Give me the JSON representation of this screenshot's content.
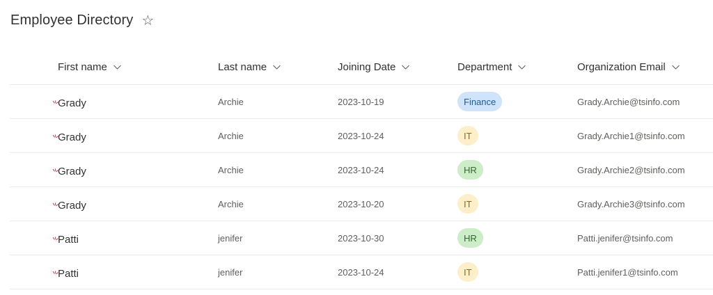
{
  "header": {
    "title": "Employee Directory",
    "favorite_icon": "star-outline-icon"
  },
  "columns": [
    {
      "key": "first_name",
      "label": "First name"
    },
    {
      "key": "last_name",
      "label": "Last name"
    },
    {
      "key": "joining_date",
      "label": "Joining Date"
    },
    {
      "key": "department",
      "label": "Department"
    },
    {
      "key": "email",
      "label": "Organization Email"
    }
  ],
  "department_colors": {
    "Finance": {
      "bg": "#cfe4fa",
      "fg": "#1e5a93"
    },
    "IT": {
      "bg": "#fcefc9",
      "fg": "#8a6d1c"
    },
    "HR": {
      "bg": "#cdecc8",
      "fg": "#2e6b2a"
    }
  },
  "new_item_icon": "new-item-sparkle-icon",
  "rows": [
    {
      "first_name": "Grady",
      "last_name": "Archie",
      "joining_date": "2023-10-19",
      "department": "Finance",
      "email": "Grady.Archie@tsinfo.com"
    },
    {
      "first_name": "Grady",
      "last_name": "Archie",
      "joining_date": "2023-10-24",
      "department": "IT",
      "email": "Grady.Archie1@tsinfo.com"
    },
    {
      "first_name": "Grady",
      "last_name": "Archie",
      "joining_date": "2023-10-24",
      "department": "HR",
      "email": "Grady.Archie2@tsinfo.com"
    },
    {
      "first_name": "Grady",
      "last_name": "Archie",
      "joining_date": "2023-10-20",
      "department": "IT",
      "email": "Grady.Archie3@tsinfo.com"
    },
    {
      "first_name": "Patti",
      "last_name": "jenifer",
      "joining_date": "2023-10-30",
      "department": "HR",
      "email": "Patti.jenifer@tsinfo.com"
    },
    {
      "first_name": "Patti",
      "last_name": "jenifer",
      "joining_date": "2023-10-24",
      "department": "IT",
      "email": "Patti.jenifer1@tsinfo.com"
    }
  ]
}
